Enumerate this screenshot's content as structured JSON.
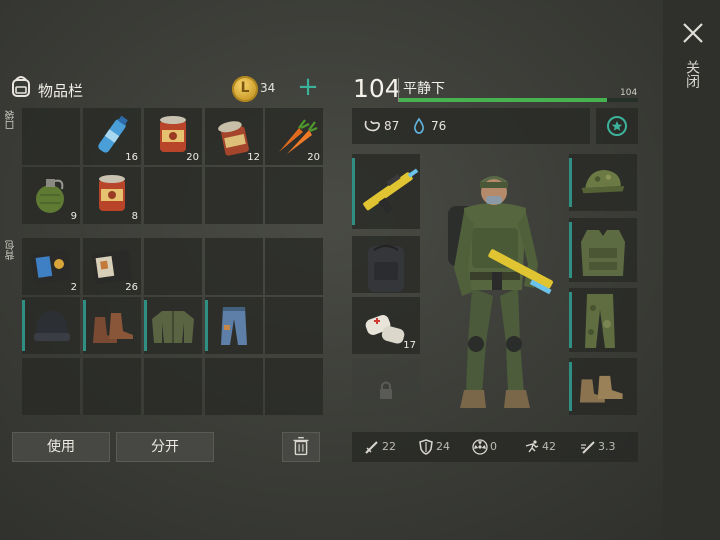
{
  "window": {
    "close_label": "关闭"
  },
  "inventory": {
    "title": "物品栏",
    "coins": "34",
    "pockets_label": "口袋",
    "backpack_label": "背包",
    "items": [
      {
        "name": "water-bottle",
        "count": "16"
      },
      {
        "name": "canned-food",
        "count": "20"
      },
      {
        "name": "opened-can",
        "count": "12"
      },
      {
        "name": "carrots",
        "count": "20"
      },
      {
        "name": "grenade",
        "count": "9"
      },
      {
        "name": "canned-food",
        "count": "8"
      },
      {
        "name": "id-wallet-blue",
        "count": "2"
      },
      {
        "name": "id-wallet-orange",
        "count": "26"
      },
      {
        "name": "beanie-hat",
        "count": ""
      },
      {
        "name": "leather-boots",
        "count": ""
      },
      {
        "name": "bomber-jacket",
        "count": ""
      },
      {
        "name": "jeans",
        "count": ""
      }
    ],
    "use_button": "使用",
    "split_button": "分开"
  },
  "character": {
    "level": "104",
    "mood": "平静下",
    "max_hp": "104",
    "hp_fraction": 0.87,
    "stomach": "87",
    "water": "76",
    "equipment_left": [
      {
        "name": "assault-rifle",
        "count": ""
      },
      {
        "name": "tactical-backpack",
        "count": ""
      },
      {
        "name": "bandages",
        "count": "17"
      },
      {
        "name": "locked-slot",
        "count": ""
      }
    ],
    "equipment_right": [
      {
        "name": "camo-cap"
      },
      {
        "name": "tactical-vest"
      },
      {
        "name": "camo-pants"
      },
      {
        "name": "combat-boots"
      }
    ],
    "stats": {
      "attack": "22",
      "armor": "24",
      "radiation": "0",
      "speed": "42",
      "attack_speed": "3.3"
    }
  },
  "colors": {
    "accent": "#3bb39a",
    "hp_bar": "#47b350",
    "slot_bar": "#2f8f82"
  }
}
